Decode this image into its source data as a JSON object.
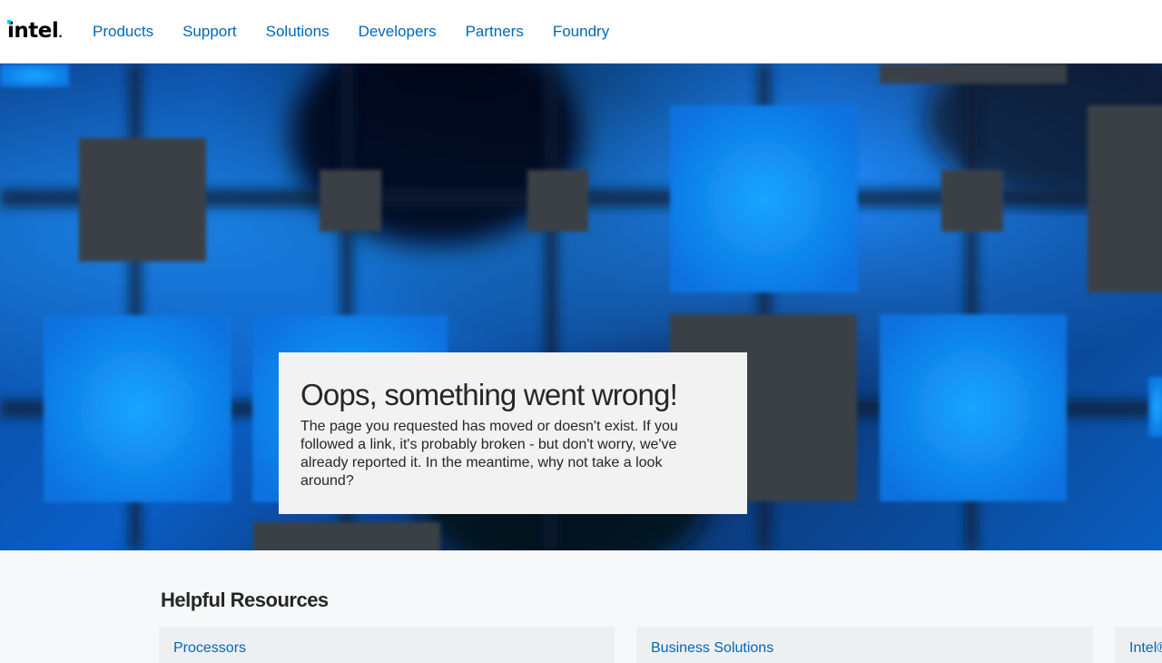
{
  "header": {
    "logo_text": "intel",
    "nav": [
      "Products",
      "Support",
      "Solutions",
      "Developers",
      "Partners",
      "Foundry"
    ]
  },
  "hero": {
    "error_title": "Oops, something went wrong!",
    "error_message": "The page you requested has moved or doesn't exist. If you followed a link, it's probably broken - but don't worry, we've already reported it. In the meantime, why not take a look around?"
  },
  "resources": {
    "title": "Helpful Resources",
    "cards": [
      "Processors",
      "Business Solutions",
      "Intel®"
    ]
  },
  "colors": {
    "link": "#0068b5",
    "brand_dot": "#00c7fd",
    "card_bg": "#f2f2f2"
  }
}
